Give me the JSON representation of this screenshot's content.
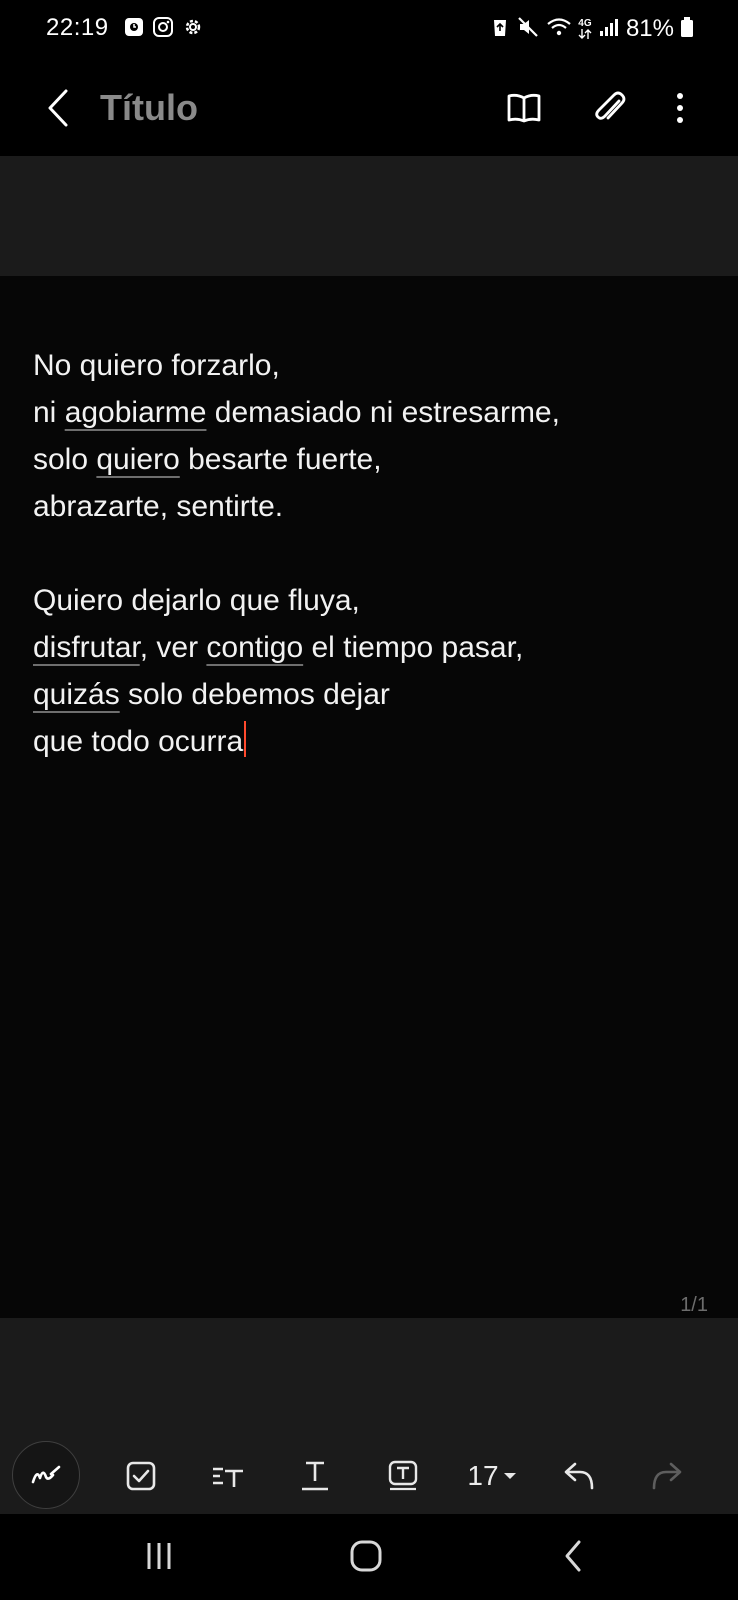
{
  "status_bar": {
    "time": "22:19",
    "battery": "81%",
    "network_type": "4G",
    "left_icons": [
      "notification-badge-icon",
      "instagram-icon",
      "settings-gear-icon"
    ],
    "right_icons": [
      "recycle-icon",
      "mute-icon",
      "wifi-icon",
      "network-4g-icon",
      "signal-icon",
      "battery-icon"
    ]
  },
  "header": {
    "title_placeholder": "Título",
    "icons": [
      "back-icon",
      "reading-mode-book-icon",
      "attach-paperclip-icon",
      "more-options-icon"
    ]
  },
  "note": {
    "lines": [
      {
        "text": "No quiero forzarlo,"
      },
      {
        "pre": "ni ",
        "squiggle": "agobiarme",
        "post": " demasiado ni estresarme,"
      },
      {
        "pre": "solo ",
        "squiggle": "quiero",
        "post": " besarte fuerte,"
      },
      {
        "text": "abrazarte, sentirte."
      },
      {
        "text": ""
      },
      {
        "text": "Quiero dejarlo que fluya,"
      },
      {
        "pre": "",
        "squiggle": "disfrutar",
        "post": ", ver ",
        "squiggle2": "contigo",
        "post2": " el tiempo pasar,"
      },
      {
        "pre": "",
        "squiggle": "quizás",
        "post": " solo debemos dejar"
      },
      {
        "text": "que todo ocurra"
      }
    ],
    "page_indicator": "1/1"
  },
  "format_toolbar": {
    "font_size": "17",
    "tools": [
      "pen-icon",
      "checkbox-icon",
      "text-style-icon",
      "underline-text-icon",
      "text-box-icon",
      "font-size-dropdown",
      "undo-icon",
      "redo-icon"
    ],
    "colors": {
      "active": "#e8e8e8",
      "disabled": "#5e5e5e",
      "caret": "#ff4a2e"
    }
  },
  "nav_bar": {
    "icons": [
      "recents-icon",
      "home-icon",
      "back-nav-icon"
    ]
  }
}
